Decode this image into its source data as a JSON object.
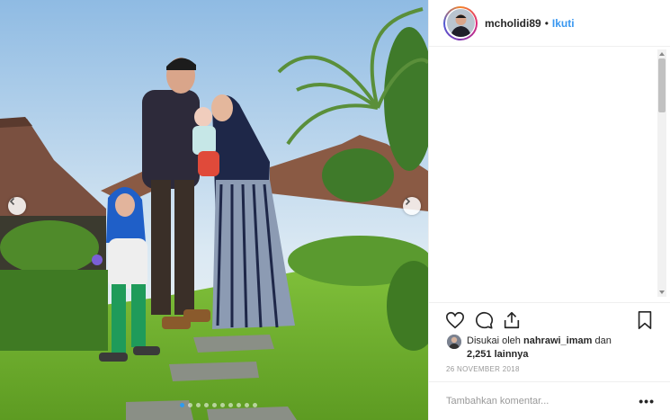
{
  "post": {
    "username": "mcholidi89",
    "separator": "•",
    "follow_label": "Ikuti",
    "carousel_total": 10,
    "carousel_active": 0
  },
  "likes": {
    "prefix": "Disukai oleh",
    "liker": "nahrawi_imam",
    "conjunction": "dan",
    "count_text": "2,251 lainnya"
  },
  "timestamp": "26 NOVEMBER 2018",
  "comment": {
    "placeholder": "Tambahkan komentar...",
    "more_label": "•••"
  },
  "icons": {
    "like": "heart-icon",
    "comment": "comment-bubble-icon",
    "share": "share-icon",
    "save": "bookmark-icon",
    "prev": "chevron-left-icon",
    "next": "chevron-right-icon"
  },
  "colors": {
    "link": "#3897f0",
    "text": "#262626",
    "muted": "#999999",
    "dot_active": "#2e9bf0"
  }
}
